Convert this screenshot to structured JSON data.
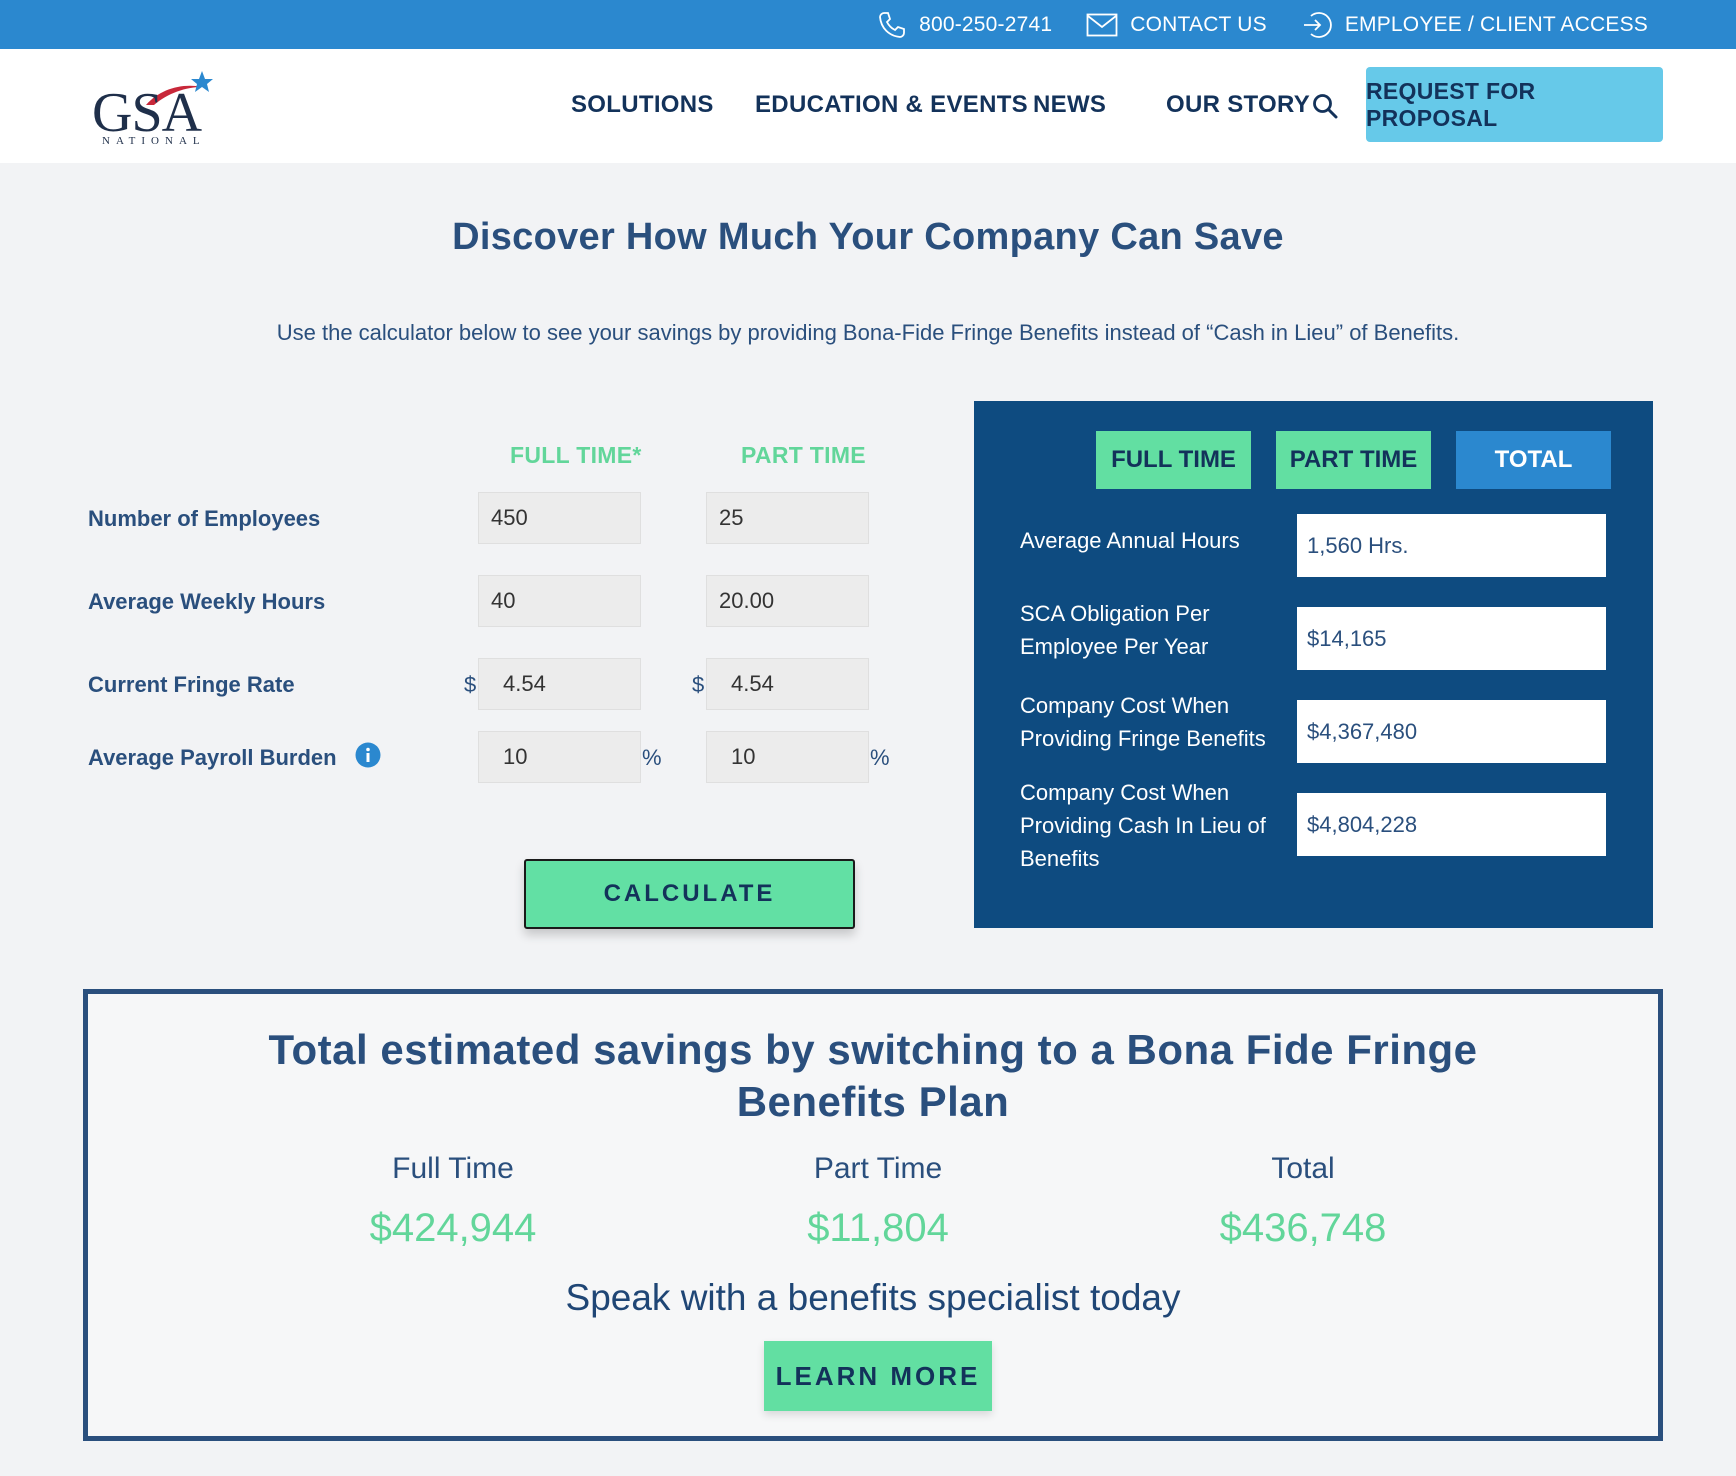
{
  "topbar": {
    "phone": "800-250-2741",
    "contact": "CONTACT US",
    "access": "EMPLOYEE / CLIENT ACCESS"
  },
  "header": {
    "logo_main": "GSA",
    "logo_sub": "NATIONAL",
    "nav": [
      "SOLUTIONS",
      "EDUCATION & EVENTS",
      "NEWS",
      "OUR STORY"
    ],
    "rfp_label": "REQUEST FOR PROPOSAL"
  },
  "main": {
    "title": "Discover How Much Your Company Can Save",
    "intro": "Use the calculator below to see your savings by providing Bona-Fide Fringe Benefits instead of “Cash in Lieu” of Benefits."
  },
  "calculator": {
    "col_full": "FULL TIME*",
    "col_part": "PART TIME",
    "rows": [
      {
        "label": "Number of Employees",
        "full": "450",
        "part": "25"
      },
      {
        "label": "Average Weekly Hours",
        "full": "40",
        "part": "20.00"
      },
      {
        "label": "Current Fringe Rate",
        "full": "4.54",
        "part": "4.54"
      },
      {
        "label": "Average Payroll Burden",
        "full": "10",
        "part": "10"
      }
    ],
    "currency_symbol": "$",
    "percent_symbol": "%",
    "calculate_label": "CALCULATE"
  },
  "results": {
    "tabs": [
      "FULL TIME",
      "PART TIME",
      "TOTAL"
    ],
    "active_tab": "TOTAL",
    "rows": [
      {
        "label": "Average Annual Hours",
        "value": "1,560 Hrs."
      },
      {
        "label": "SCA Obligation Per Employee Per Year",
        "value": "$14,165"
      },
      {
        "label": "Company Cost When Providing Fringe Benefits",
        "value": "$4,367,480"
      },
      {
        "label": "Company Cost When Providing Cash In Lieu of Benefits",
        "value": "$4,804,228"
      }
    ]
  },
  "savings": {
    "title_line1": "Total estimated savings by switching to a Bona Fide Fringe",
    "title_line2": "Benefits Plan",
    "columns": [
      {
        "label": "Full Time",
        "value": "$424,944"
      },
      {
        "label": "Part Time",
        "value": "$11,804"
      },
      {
        "label": "Total",
        "value": "$436,748"
      }
    ],
    "cta_text": "Speak with a benefits specialist today",
    "learn_more_label": "LEARN MORE"
  },
  "colors": {
    "topbar": "#2b88cf",
    "navy": "#0e4b80",
    "accent_green": "#62dfa2",
    "rfp_blue": "#66c9e9",
    "text_blue": "#2a4f7d"
  }
}
